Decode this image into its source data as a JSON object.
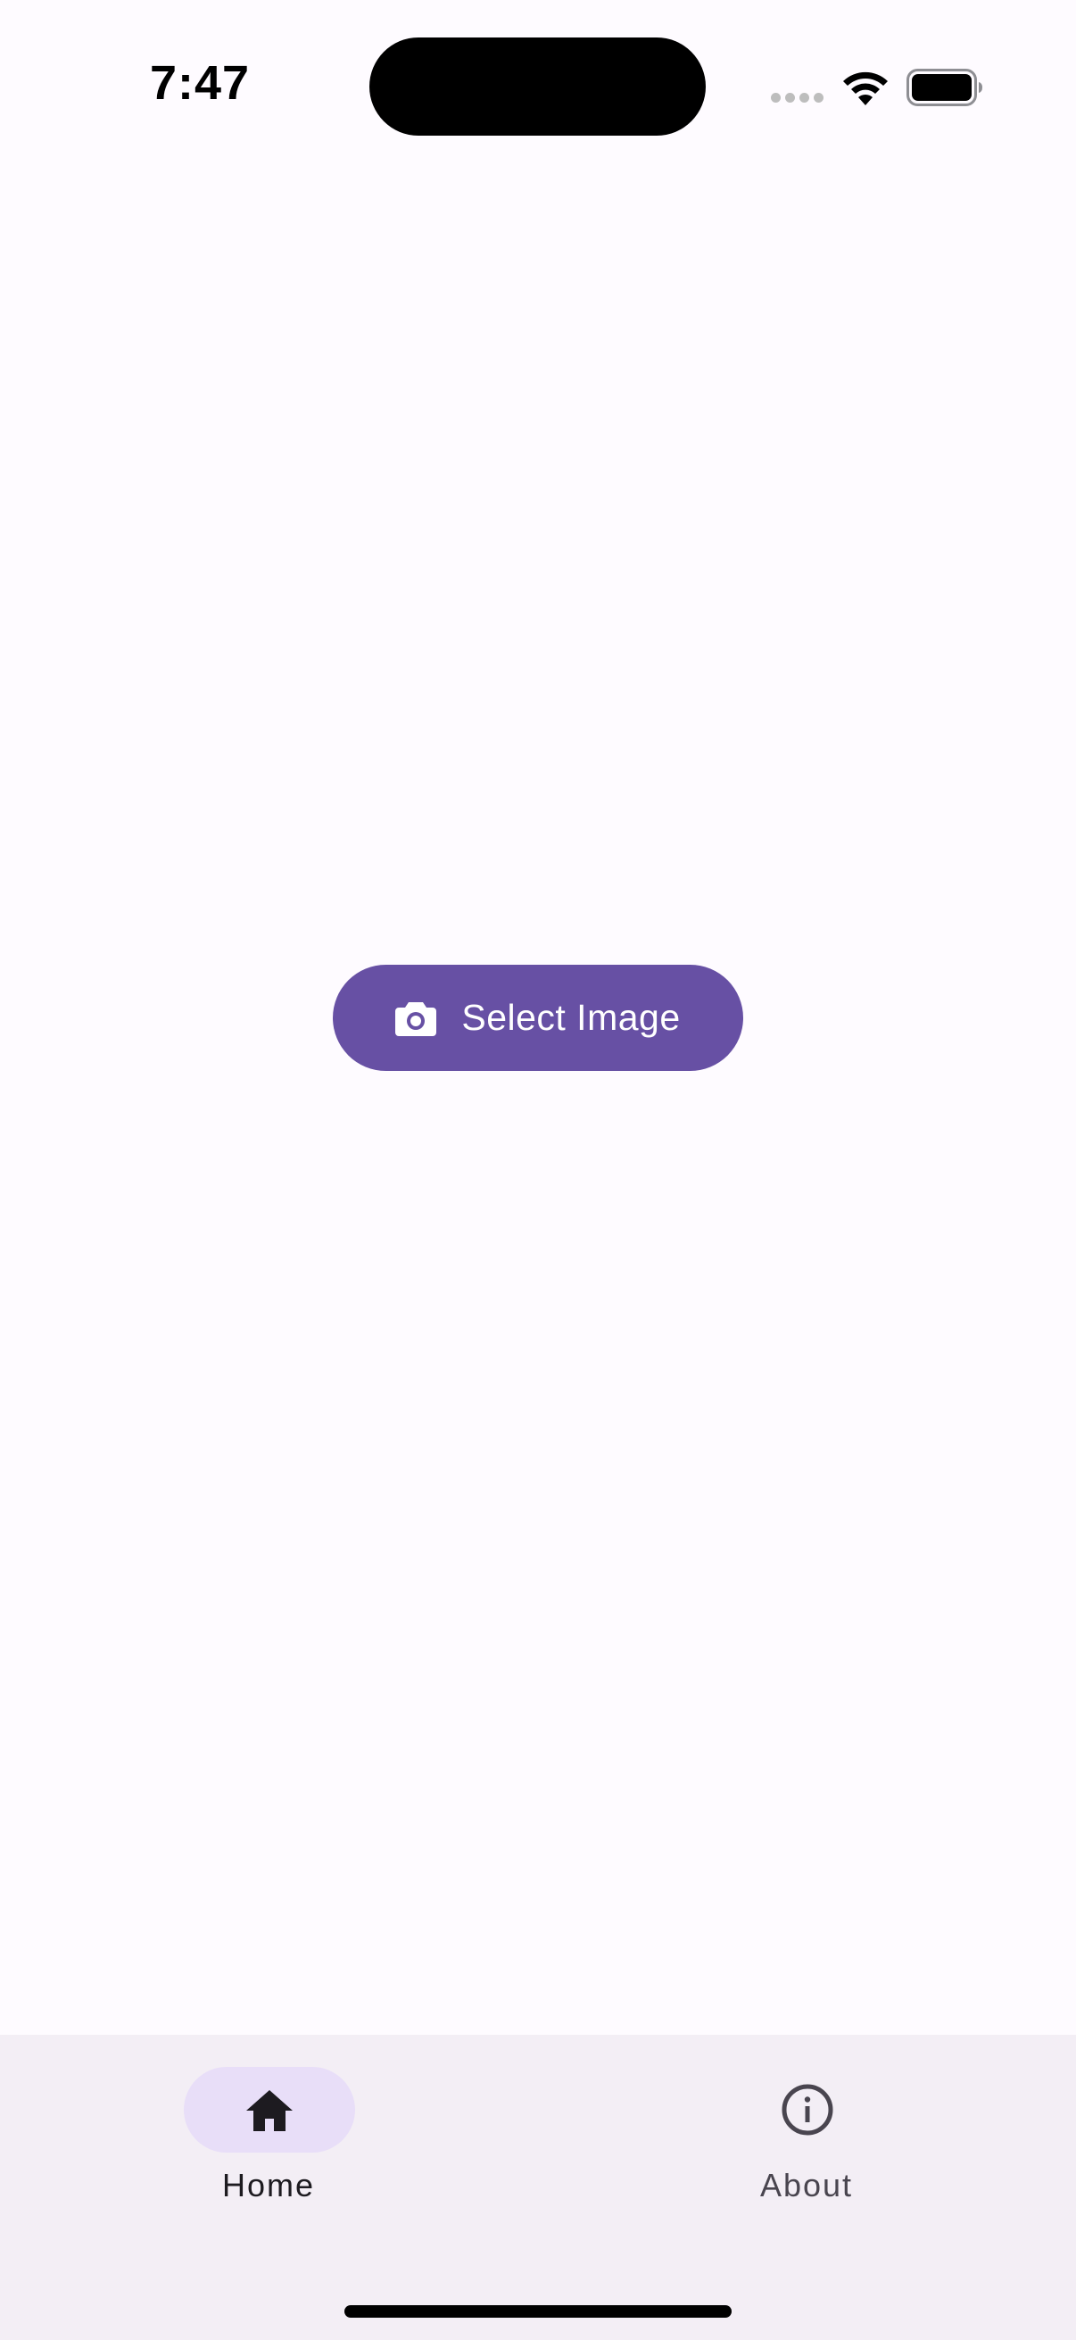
{
  "status_bar": {
    "time": "7:47"
  },
  "main": {
    "select_button": {
      "icon": "camera-icon",
      "label": "Select Image"
    }
  },
  "bottom_nav": {
    "items": [
      {
        "label": "Home",
        "icon": "home-icon",
        "selected": true
      },
      {
        "label": "About",
        "icon": "info-icon",
        "selected": false
      }
    ]
  },
  "colors": {
    "background": "#FEFBFF",
    "primary": "#6750A4",
    "on_primary": "#FFFFFF",
    "nav_background": "#F3EEF5",
    "nav_indicator": "#E8DEF8",
    "on_surface": "#1D1B20",
    "on_surface_variant": "#49454F"
  }
}
